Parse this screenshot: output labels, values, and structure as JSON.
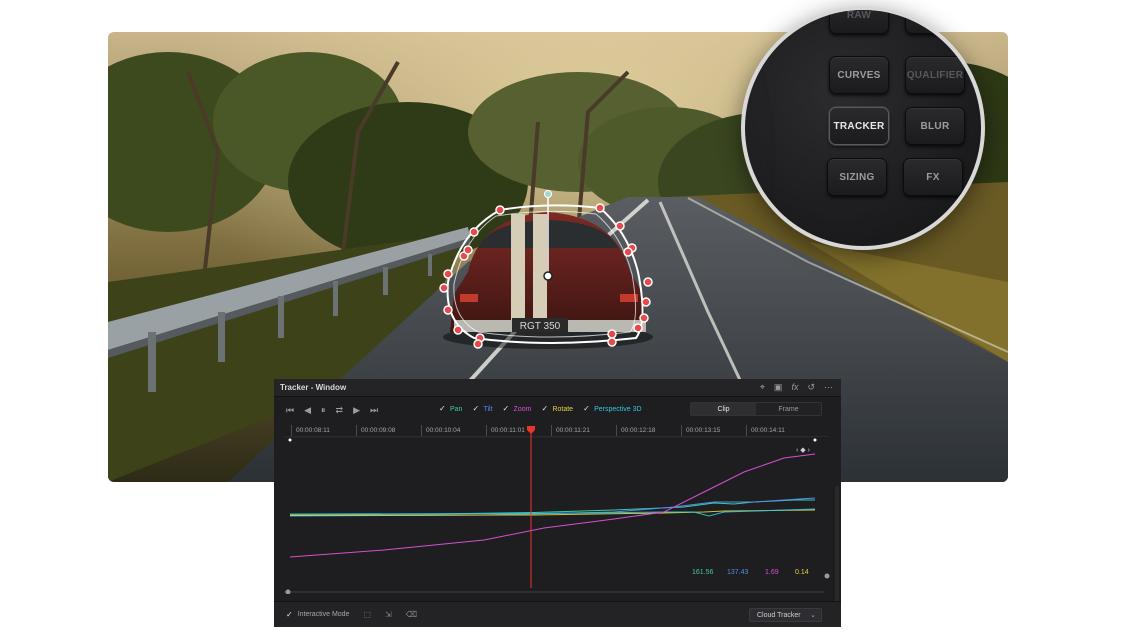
{
  "panel": {
    "keys": [
      "RAW",
      "CURVES",
      "QUALIFIER",
      "TRACKER",
      "BLUR",
      "SIZING",
      "FX"
    ],
    "active_key": "TRACKER"
  },
  "plate": {
    "text": "RGT 350"
  },
  "tracker": {
    "title": "Tracker - Window",
    "header_icons": [
      "crosshair-icon",
      "camera-icon",
      "fx-icon",
      "reset-icon",
      "more-icon"
    ],
    "transport_icons": [
      "skip-start-icon",
      "step-back-icon",
      "pause-icon",
      "loop-icon",
      "play-icon",
      "skip-end-icon"
    ],
    "params": [
      {
        "label": "Pan",
        "color": "#3fc9a0",
        "checked": true
      },
      {
        "label": "Tilt",
        "color": "#4e8fe8",
        "checked": true
      },
      {
        "label": "Zoom",
        "color": "#d64fd0",
        "checked": true
      },
      {
        "label": "Rotate",
        "color": "#e6d23c",
        "checked": true
      },
      {
        "label": "Perspective 3D",
        "color": "#34c6e0",
        "checked": true
      }
    ],
    "mode_tabs": {
      "clip": "Clip",
      "frame": "Frame",
      "selected": "Clip"
    },
    "timecodes": [
      "00:00:08:11",
      "00:00:09:08",
      "00:00:10:04",
      "00:00:11:01",
      "00:00:11:21",
      "00:00:12:18",
      "00:00:13:15",
      "00:00:14:11"
    ],
    "readouts": [
      {
        "value": "161.56",
        "color": "#3fc9a0"
      },
      {
        "value": "137.43",
        "color": "#4e8fe8"
      },
      {
        "value": "1.69",
        "color": "#d64fd0"
      },
      {
        "value": "0.14",
        "color": "#e6d23c"
      }
    ],
    "footer": {
      "interactive_mode": "Interactive Mode",
      "interactive_checked": true,
      "cloud_tracker": "Cloud Tracker"
    },
    "playhead_color": "#e8362a"
  }
}
